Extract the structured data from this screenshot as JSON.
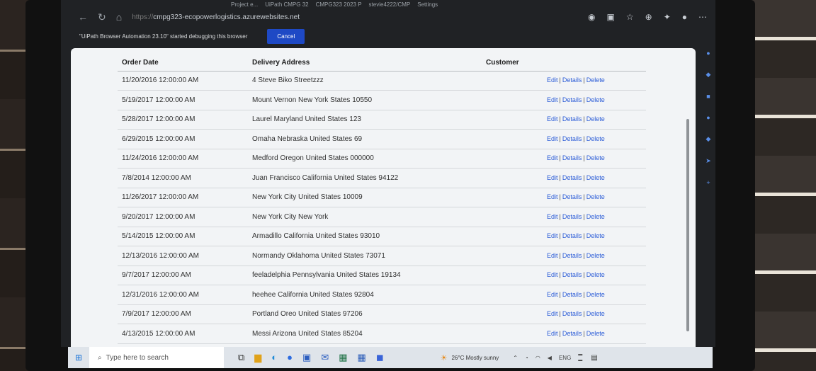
{
  "browser": {
    "tabs": [
      "Project e...",
      "UiPath CMPG 32",
      "CMPG323 2023 P",
      "stevie4222/CMP",
      "Settings"
    ],
    "url_host": "cmpg323-ecopowerlogistics.azurewebsites.net",
    "url_prefix": "https://"
  },
  "infobar": {
    "message": "\"UiPath Browser Automation 23.10\" started debugging this browser",
    "cancel_label": "Cancel"
  },
  "table": {
    "headers": {
      "order_date": "Order Date",
      "delivery_address": "Delivery Address",
      "customer": "Customer"
    },
    "action_labels": {
      "edit": "Edit",
      "details": "Details",
      "delete": "Delete",
      "separator": "|"
    },
    "rows": [
      {
        "order_date": "11/20/2016 12:00:00 AM",
        "delivery_address": "4 Steve Biko Streetzzz",
        "customer": ""
      },
      {
        "order_date": "5/19/2017 12:00:00 AM",
        "delivery_address": "Mount Vernon New York States 10550",
        "customer": ""
      },
      {
        "order_date": "5/28/2017 12:00:00 AM",
        "delivery_address": "Laurel Maryland United States 123",
        "customer": ""
      },
      {
        "order_date": "6/29/2015 12:00:00 AM",
        "delivery_address": "Omaha Nebraska United States 69",
        "customer": ""
      },
      {
        "order_date": "11/24/2016 12:00:00 AM",
        "delivery_address": "Medford Oregon United States 000000",
        "customer": ""
      },
      {
        "order_date": "7/8/2014 12:00:00 AM",
        "delivery_address": "Juan Francisco California United States 94122",
        "customer": ""
      },
      {
        "order_date": "11/26/2017 12:00:00 AM",
        "delivery_address": "New York City United States 10009",
        "customer": ""
      },
      {
        "order_date": "9/20/2017 12:00:00 AM",
        "delivery_address": "New York City New York",
        "customer": ""
      },
      {
        "order_date": "5/14/2015 12:00:00 AM",
        "delivery_address": "Armadillo California United States 93010",
        "customer": ""
      },
      {
        "order_date": "12/13/2016 12:00:00 AM",
        "delivery_address": "Normandy Oklahoma United States 73071",
        "customer": ""
      },
      {
        "order_date": "9/7/2017 12:00:00 AM",
        "delivery_address": "feeladelphia Pennsylvania United States 19134",
        "customer": ""
      },
      {
        "order_date": "12/31/2016 12:00:00 AM",
        "delivery_address": "heehee California United States 92804",
        "customer": ""
      },
      {
        "order_date": "7/9/2017 12:00:00 AM",
        "delivery_address": "Portland Oreo United States 97206",
        "customer": ""
      },
      {
        "order_date": "4/13/2015 12:00:00 AM",
        "delivery_address": "Messi Arizona United States 85204",
        "customer": ""
      }
    ]
  },
  "taskbar": {
    "search_placeholder": "Type here to search",
    "weather": "26°C  Mostly sunny",
    "language": "ENG"
  },
  "colors": {
    "link": "#2a5bd7",
    "cancel_button": "#1e49c5",
    "page_bg": "#f2f4f6"
  }
}
